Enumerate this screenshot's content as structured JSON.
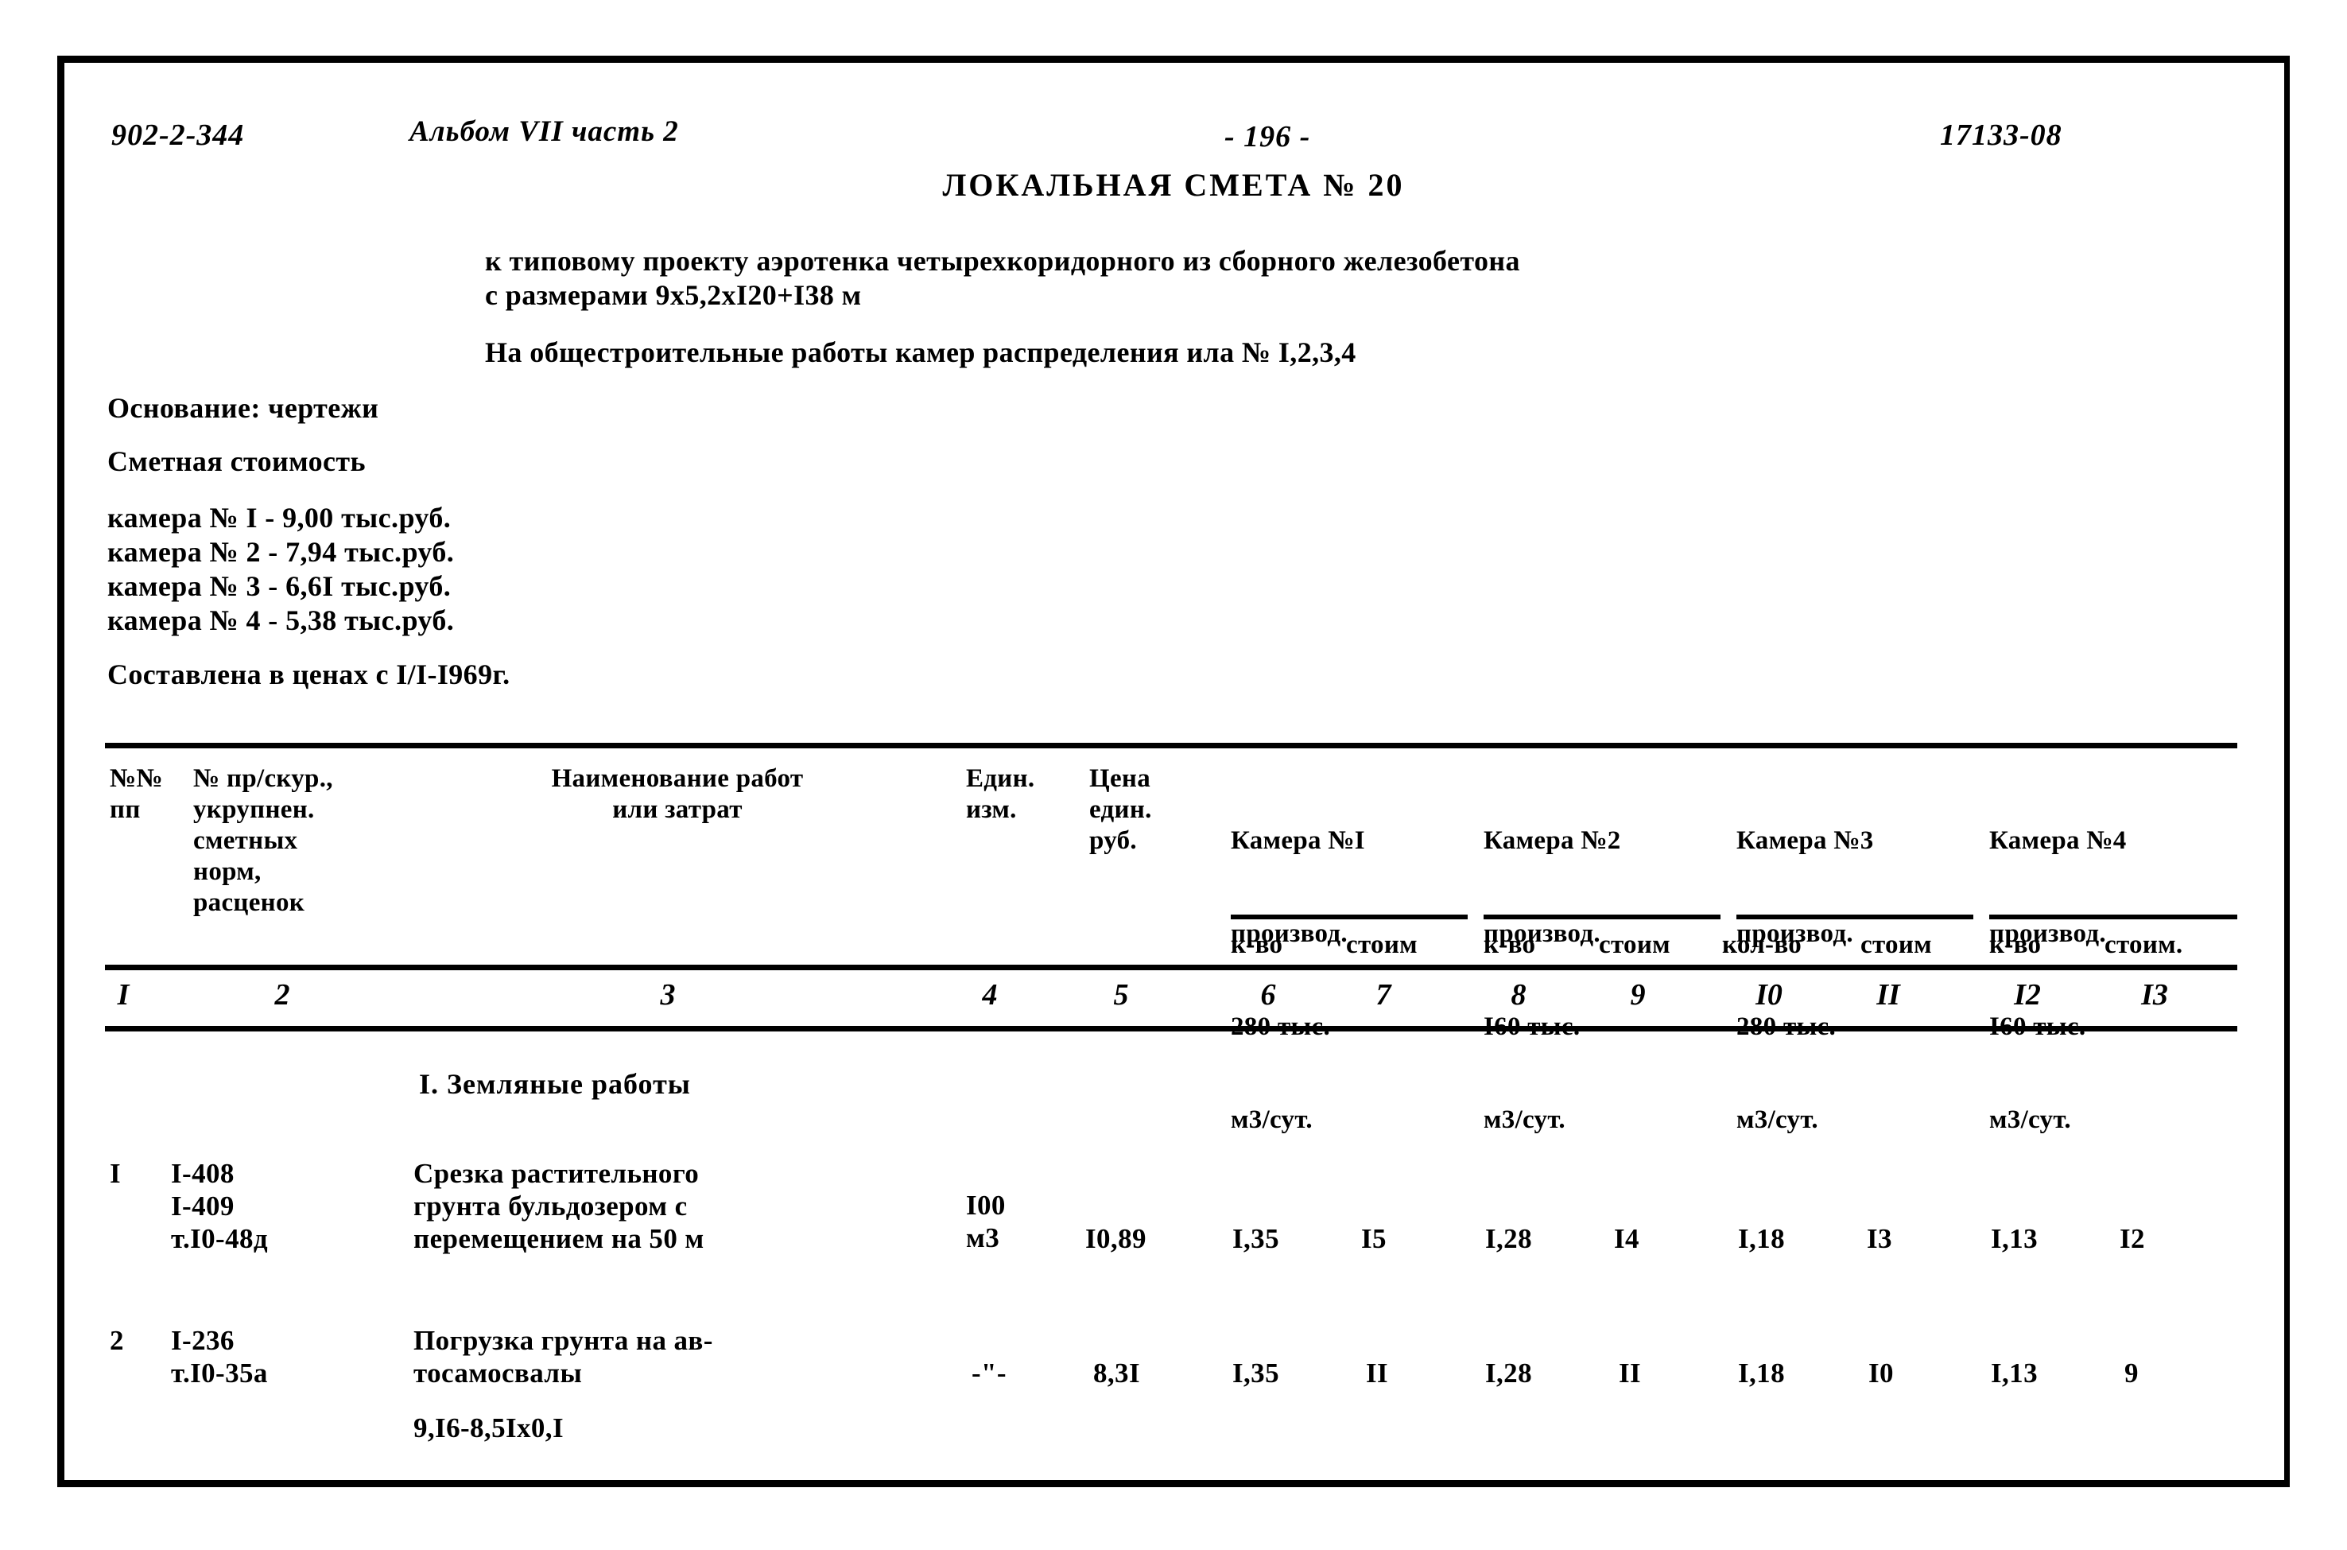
{
  "header": {
    "doc_code": "902-2-344",
    "album": "Альбом VII часть 2",
    "page_number": "- 196 -",
    "sheet_code": "17133-08"
  },
  "title": {
    "main": "ЛОКАЛЬНАЯ СМЕТА № 20",
    "project_line1": "к типовому проекту аэротенка четырехкоридорного из сборного железобетона",
    "project_line2": "с размерами 9х5,2хI20+I38 м",
    "work_scope": "На общестроительные работы камер распределения ила № I,2,3,4"
  },
  "preamble": {
    "basis_label": "Основание: чертежи",
    "cost_label": "Сметная стоимость",
    "costs": [
      "камера № I - 9,00 тыс.руб.",
      "камера № 2 - 7,94 тыс.руб.",
      "камера № 3 - 6,6I тыс.руб.",
      "камера № 4 - 5,38 тыс.руб."
    ],
    "prices_note": "Составлена в ценах с I/I-I969г."
  },
  "table": {
    "headers": {
      "pp": "№№\nпп",
      "norms": "№ пр/скур.,\nукрупнен.\nсметных\nнорм,\nрасценок",
      "name": "Наименование работ\nили затрат",
      "unit": "Един.\nизм.",
      "price": "Цена\nедин.\nруб.",
      "cameras": [
        {
          "title": "Камера №I",
          "capacity_line1": "производ.",
          "capacity_line2": "280 тыс.",
          "capacity_line3": "м3/сут.",
          "sub_qty": "к-во",
          "sub_cost": "стоим"
        },
        {
          "title": "Камера №2",
          "capacity_line1": "производ.",
          "capacity_line2": "I60 тыс.",
          "capacity_line3": "м3/сут.",
          "sub_qty": "к-во",
          "sub_cost": "стоим"
        },
        {
          "title": "Камера №3",
          "capacity_line1": "производ.",
          "capacity_line2": "280 тыс.",
          "capacity_line3": "м3/сут.",
          "sub_qty": "кол-во",
          "sub_cost": "стоим"
        },
        {
          "title": "Камера №4",
          "capacity_line1": "производ.",
          "capacity_line2": "I60 тыс.",
          "capacity_line3": "м3/сут.",
          "sub_qty": "к-во",
          "sub_cost": "стоим."
        }
      ]
    },
    "column_numbers": [
      "I",
      "2",
      "3",
      "4",
      "5",
      "6",
      "7",
      "8",
      "9",
      "I0",
      "II",
      "I2",
      "I3"
    ],
    "section_title": "I. Земляные работы",
    "rows": [
      {
        "pp": "I",
        "norms": "I-408\nI-409\nт.I0-48д",
        "name": "Срезка растительного\nгрунта бульдозером с\nперемещением на 50 м",
        "unit": "I00\nм3",
        "price": "I0,89",
        "c1_qty": "I,35",
        "c1_cost": "I5",
        "c2_qty": "I,28",
        "c2_cost": "I4",
        "c3_qty": "I,18",
        "c3_cost": "I3",
        "c4_qty": "I,13",
        "c4_cost": "I2"
      },
      {
        "pp": "2",
        "norms": "I-236\nт.I0-35а",
        "name": "Погрузка грунта на ав-\nтосамосвалы",
        "name_extra": "9,I6-8,5Iх0,I",
        "unit": "-\"-",
        "price": "8,3I",
        "c1_qty": "I,35",
        "c1_cost": "II",
        "c2_qty": "I,28",
        "c2_cost": "II",
        "c3_qty": "I,18",
        "c3_cost": "I0",
        "c4_qty": "I,13",
        "c4_cost": "9"
      }
    ]
  }
}
